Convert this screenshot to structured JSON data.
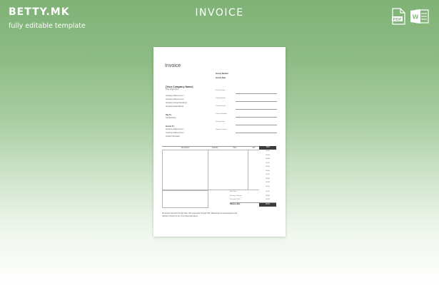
{
  "brand": {
    "logo_text": "BETTY.MK",
    "tagline": "fully editable template"
  },
  "header": {
    "title": "INVOICE"
  },
  "formats": [
    {
      "name": "pdf-format",
      "label": "PDF",
      "color": "#ffffff"
    },
    {
      "name": "word-format",
      "label": "W",
      "color": "#ffffff"
    }
  ],
  "document": {
    "title": "Invoice",
    "company_name": "[Your Company Name]",
    "company_origin": "[Your Origin Here]",
    "company_lines": [
      "Company Address Line 1",
      "Company Address Line 2",
      "Company Contact Number(s)",
      "Company Email Address"
    ],
    "pay_to_label": "Pay To:",
    "pay_to_lines": [
      "Contact Name"
    ],
    "invoice_number_label": "Invoice Number",
    "invoice_date_label": "Invoice Date",
    "right_fields": [
      "Date of Order",
      "Order Number",
      "Ordered From",
      "Contact Number",
      "Delivery Date",
      "Payment Terms"
    ],
    "bill_to_label": "Invoice To:",
    "bill_to_lines": [
      "Customer Address Line 1",
      "Customer Address Line 2",
      "Contact Information"
    ],
    "table_headers": {
      "description": "Description",
      "quantity": "Quantity",
      "price": "Price",
      "vat": "VAT",
      "total": "Total"
    },
    "amounts": [
      "00.00",
      "00.00",
      "00.00",
      "00.00",
      "00.00",
      "00.00",
      "00.00",
      "00.00",
      "00.00",
      "00.00"
    ],
    "summary_rows": [
      {
        "label": "Sub-Total",
        "value": "00.00"
      },
      {
        "label": "Delivery Charges",
        "value": "00.00"
      },
      {
        "label": "Discount / Offs",
        "value": "00.00"
      }
    ],
    "balance_label": "Balance Due",
    "balance_value": "00.00",
    "footer_lines": [
      "We accept payments through cash, online payments through VISA, MasterCard, American Express and",
      "Cashier's Checks for any of the listed alternatives."
    ]
  }
}
